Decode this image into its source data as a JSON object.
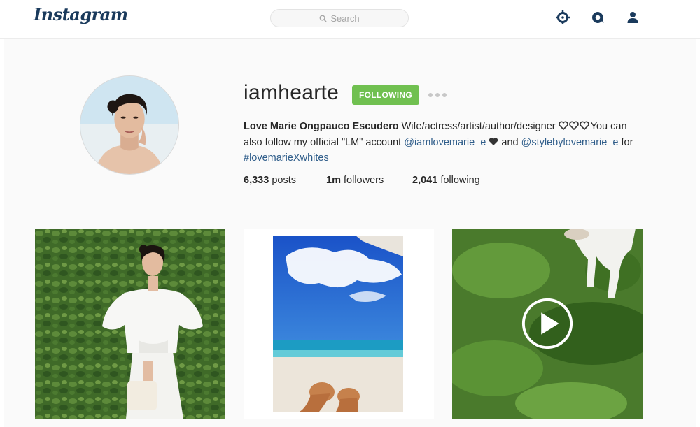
{
  "topbar": {
    "logo": "Instagram",
    "search_placeholder": "Search",
    "icons": [
      "compass-icon",
      "activity-icon",
      "profile-icon"
    ]
  },
  "profile": {
    "username": "iamhearte",
    "follow_label": "FOLLOWING",
    "full_name": "Love Marie Ongpauco Escudero",
    "bio_text_1": "Wife/actress/artist/author/designer",
    "bio_text_2": "You can also follow my official \"LM\" account",
    "bio_link_1": "@iamlovemarie_e",
    "bio_text_3": "and",
    "bio_link_2": "@stylebylovemarie_e",
    "bio_text_4": "for",
    "bio_link_3": "#lovemarieXwhites",
    "stats": {
      "posts_count": "6,333",
      "posts_label": "posts",
      "followers_count": "1m",
      "followers_label": "followers",
      "following_count": "2,041",
      "following_label": "following"
    }
  },
  "colors": {
    "follow_button": "#70c050",
    "link": "#2f5d8a",
    "logo": "#1a3a5c",
    "nav_icon": "#1a3a5c"
  },
  "posts": [
    {
      "kind": "photo",
      "subject": "woman in white dress against green leaf wall"
    },
    {
      "kind": "photo",
      "subject": "beach with blue sky and clouds"
    },
    {
      "kind": "video",
      "subject": "dog on grass",
      "icon": "play-icon"
    }
  ]
}
